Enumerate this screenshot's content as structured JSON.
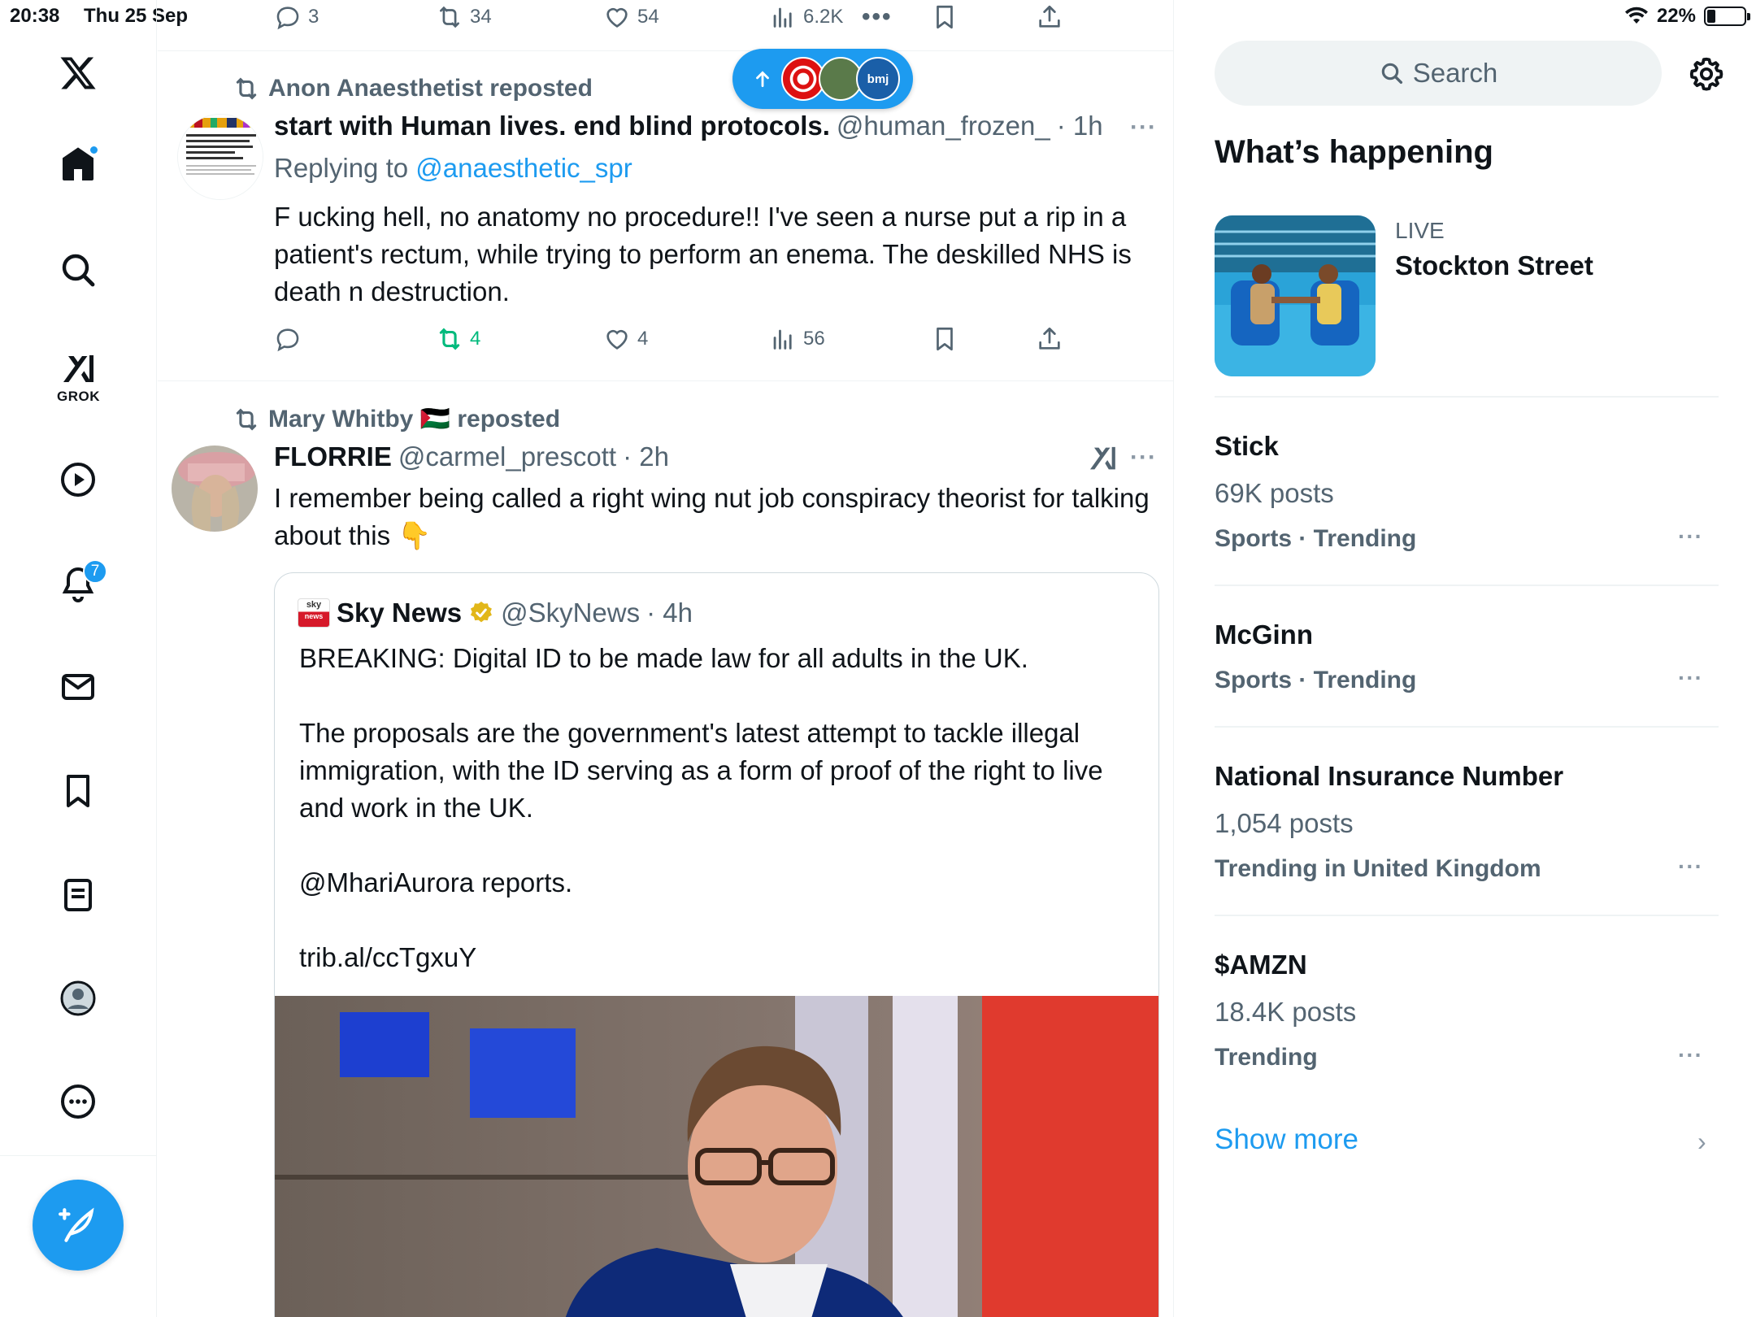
{
  "status_bar": {
    "time": "20:38",
    "date": "Thu 25 Sep",
    "battery": "22%",
    "battery_level": 0.22
  },
  "left_nav": {
    "grok_label": "GROK",
    "notifications_badge": "7",
    "brand_color": "#1d9bf0"
  },
  "top_actions": {
    "replies": "3",
    "reposts": "34",
    "likes": "54",
    "views": "6.2K"
  },
  "new_posts_pill": {
    "avatar3_label": "bmj"
  },
  "tweet1": {
    "reposted_by": "Anon Anaesthetist reposted",
    "name": "start with Human lives. end blind protocols.",
    "handle": "@human_frozen_",
    "time": "· 1h",
    "replying_prefix": "Replying to ",
    "replying_handle": "@anaesthetic_spr",
    "text": "F ucking hell, no anatomy no procedure!!  I've seen a nurse put a rip in a patient's rectum, while trying to perform an enema.  The deskilled NHS is death n destruction.",
    "reposts": "4",
    "likes": "4",
    "views": "56",
    "more": "···"
  },
  "tweet2": {
    "reposted_by": "Mary Whitby 🇵🇸 reposted",
    "name": "FLORRIE",
    "handle": "@carmel_prescott",
    "time": "· 2h",
    "text": "I remember being called a right wing nut job conspiracy theorist for talking about this 👇",
    "more": "···",
    "quote": {
      "name": "Sky News",
      "handle": "@SkyNews",
      "time": "· 4h",
      "logo_text": "sky",
      "logo_sub": "news",
      "text": "BREAKING: Digital ID to be made law for all adults in the UK.\n\nThe proposals are the government's latest attempt to tackle illegal immigration, with the ID serving as a form of proof of the right to live and work in the UK.\n\n@MhariAurora reports.\n\ntrib.al/ccTgxuY"
    }
  },
  "sidebar": {
    "search_placeholder": "Search",
    "section_title": "What’s happening",
    "live": {
      "label": "LIVE",
      "title": "Stockton Street"
    },
    "trends": [
      {
        "title": "Stick",
        "posts": "69K posts",
        "meta": "Sports · Trending"
      },
      {
        "title": "McGinn",
        "posts": "",
        "meta": "Sports · Trending"
      },
      {
        "title": "National Insurance Number",
        "posts": "1,054 posts",
        "meta": "Trending in United Kingdom"
      },
      {
        "title": "$AMZN",
        "posts": "18.4K posts",
        "meta": "Trending"
      }
    ],
    "more_glyph": "···",
    "show_more": "Show more"
  }
}
